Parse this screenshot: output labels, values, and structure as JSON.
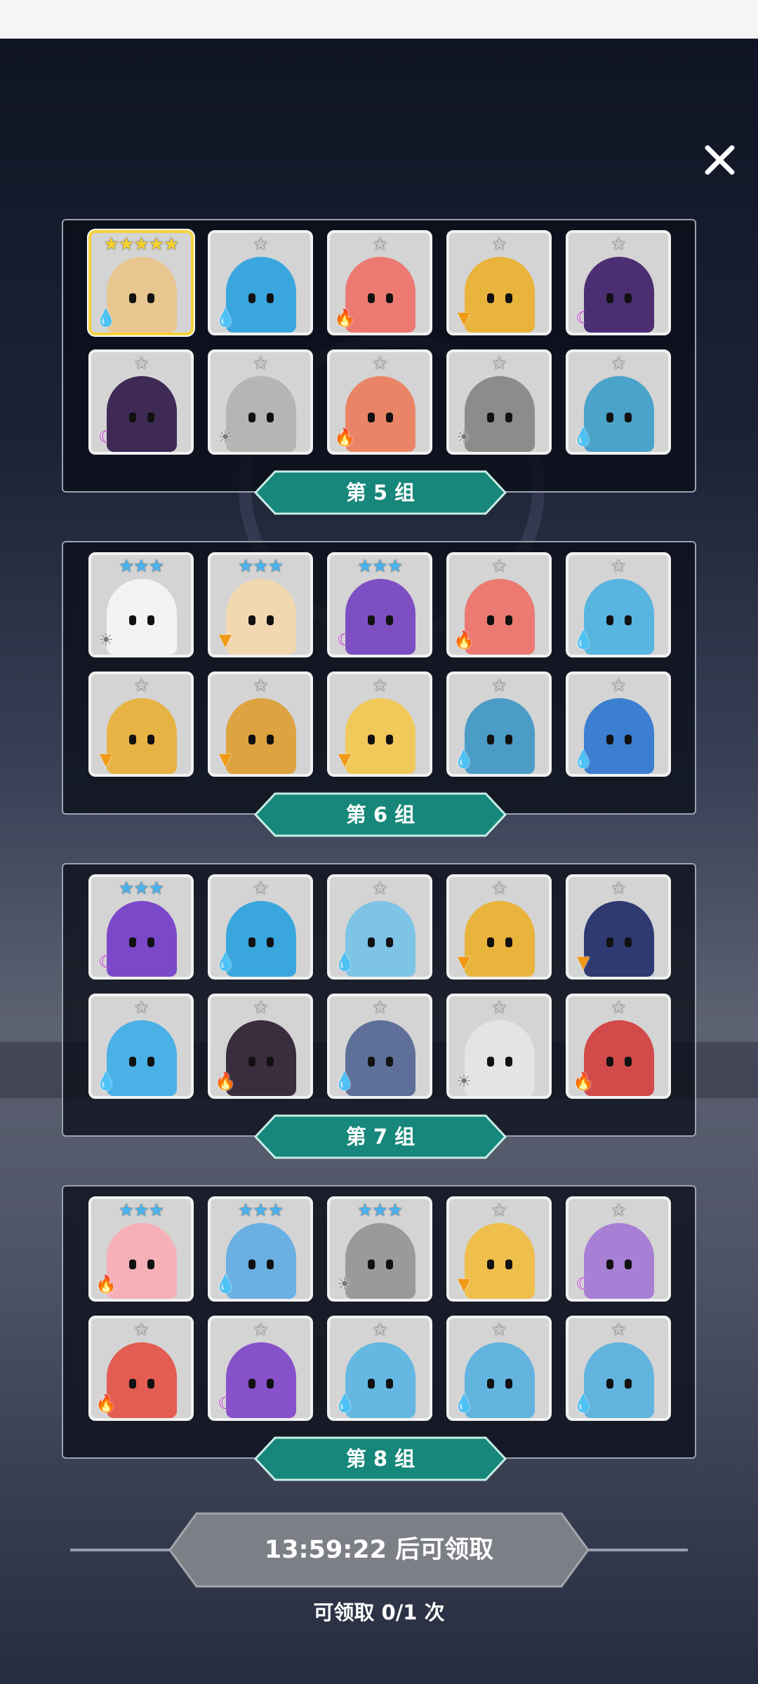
{
  "groups": [
    {
      "label": "第 5 组",
      "cards": [
        {
          "stars": "★★★★★",
          "element": "water",
          "color": "#e8c690",
          "selected": true
        },
        {
          "stars": "★",
          "element": "water",
          "color": "#3aa6de"
        },
        {
          "stars": "★",
          "element": "fire",
          "color": "#ec7a72"
        },
        {
          "stars": "★",
          "element": "wind",
          "color": "#e8b43c"
        },
        {
          "stars": "★",
          "element": "dark",
          "color": "#4c2e73"
        },
        {
          "stars": "★",
          "element": "dark",
          "color": "#3e2a55"
        },
        {
          "stars": "★",
          "element": "light",
          "color": "#b5b5b5"
        },
        {
          "stars": "★",
          "element": "fire",
          "color": "#e98566"
        },
        {
          "stars": "★",
          "element": "light",
          "color": "#8c8c8c"
        },
        {
          "stars": "★",
          "element": "water",
          "color": "#4aa3c9"
        }
      ]
    },
    {
      "label": "第 6 组",
      "cards": [
        {
          "stars": "★★★",
          "element": "light",
          "color": "#f3f3f3"
        },
        {
          "stars": "★★★",
          "element": "wind",
          "color": "#f1d8b0"
        },
        {
          "stars": "★★★",
          "element": "dark",
          "color": "#7d4fc2"
        },
        {
          "stars": "★",
          "element": "fire",
          "color": "#ec7a72"
        },
        {
          "stars": "★",
          "element": "water",
          "color": "#58b5e0"
        },
        {
          "stars": "★",
          "element": "wind",
          "color": "#e6b344"
        },
        {
          "stars": "★",
          "element": "wind",
          "color": "#dda340"
        },
        {
          "stars": "★",
          "element": "wind",
          "color": "#f0c95a"
        },
        {
          "stars": "★",
          "element": "water",
          "color": "#4b9cc6"
        },
        {
          "stars": "★",
          "element": "water",
          "color": "#3c7fd0"
        }
      ]
    },
    {
      "label": "第 7 组",
      "cards": [
        {
          "stars": "★★★",
          "element": "dark",
          "color": "#7b48c9"
        },
        {
          "stars": "★",
          "element": "water",
          "color": "#3aa6de"
        },
        {
          "stars": "★",
          "element": "water",
          "color": "#7dc4e6"
        },
        {
          "stars": "★",
          "element": "wind",
          "color": "#e8b43c"
        },
        {
          "stars": "★",
          "element": "wind",
          "color": "#2f3a73"
        },
        {
          "stars": "★",
          "element": "water",
          "color": "#4ab0e5"
        },
        {
          "stars": "★",
          "element": "fire",
          "color": "#3a2d3d"
        },
        {
          "stars": "★",
          "element": "water",
          "color": "#5e6f9a"
        },
        {
          "stars": "★",
          "element": "light",
          "color": "#e4e4e4"
        },
        {
          "stars": "★",
          "element": "fire",
          "color": "#d34a4a"
        }
      ]
    },
    {
      "label": "第 8 组",
      "cards": [
        {
          "stars": "★★★",
          "element": "fire",
          "color": "#f5b0b8"
        },
        {
          "stars": "★★★",
          "element": "water",
          "color": "#6ab0e3"
        },
        {
          "stars": "★★★",
          "element": "light",
          "color": "#9a9a9a"
        },
        {
          "stars": "★",
          "element": "wind",
          "color": "#eebf4a"
        },
        {
          "stars": "★",
          "element": "dark",
          "color": "#a77fd4"
        },
        {
          "stars": "★",
          "element": "fire",
          "color": "#e45d52"
        },
        {
          "stars": "★",
          "element": "dark",
          "color": "#8751c9"
        },
        {
          "stars": "★",
          "element": "water",
          "color": "#64b8e2"
        },
        {
          "stars": "★",
          "element": "water",
          "color": "#63b3df"
        },
        {
          "stars": "★",
          "element": "water",
          "color": "#63b3df"
        }
      ]
    }
  ],
  "element_icons": {
    "water": "💧",
    "fire": "🔥",
    "light": "☀",
    "dark": "☾",
    "wind": "▼"
  },
  "timer_label": "13:59:22 后可领取",
  "claim_label": "可领取 0/1 次",
  "colors": {
    "ribbon": "#16877a",
    "ribbon_edge": "#c9eee6",
    "timer_bg": "#7d7f86"
  }
}
